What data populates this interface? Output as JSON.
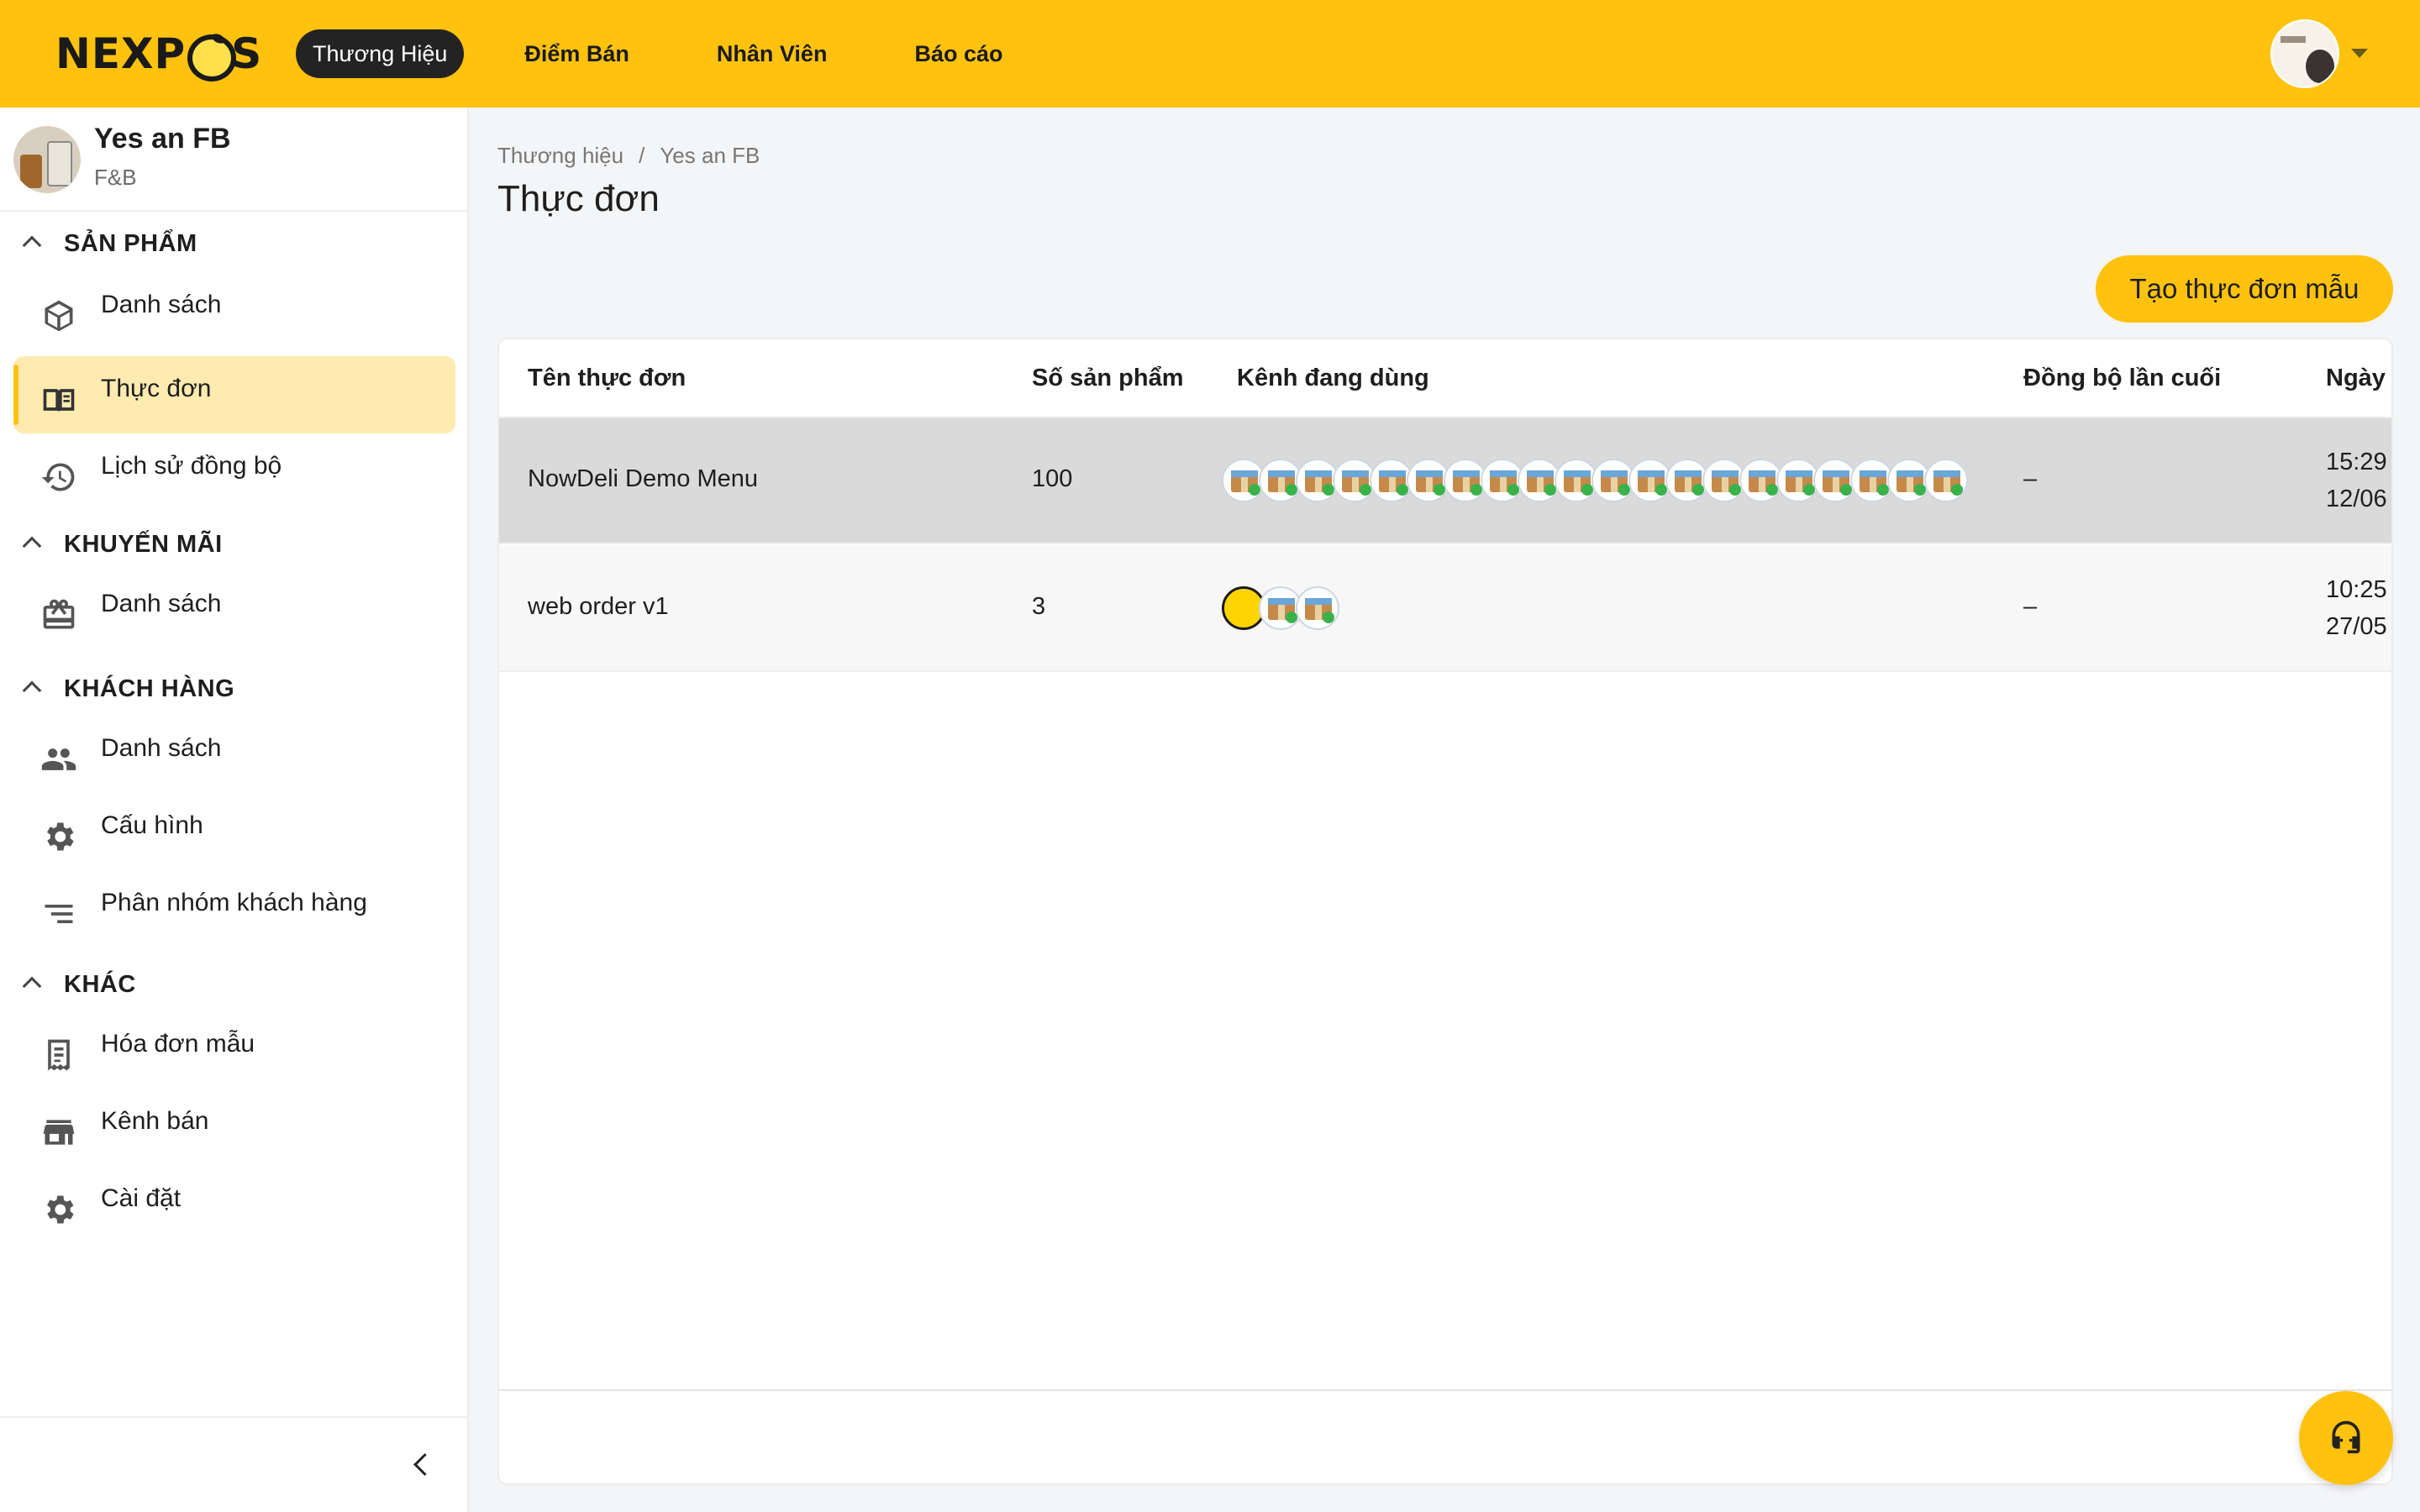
{
  "app": {
    "logo_text": "NEXPOS",
    "nav": [
      {
        "label": "Thương Hiệu",
        "active": true
      },
      {
        "label": "Điểm Bán",
        "active": false
      },
      {
        "label": "Nhân Viên",
        "active": false
      },
      {
        "label": "Báo cáo",
        "active": false
      }
    ],
    "accent_color": "#ffc20e"
  },
  "sidebar": {
    "brand": {
      "name": "Yes an FB",
      "category": "F&B"
    },
    "sections": [
      {
        "title": "SẢN PHẨM",
        "items": [
          {
            "label": "Danh sách",
            "icon": "package-icon",
            "active": false
          },
          {
            "label": "Thực đơn",
            "icon": "menu-book-icon",
            "active": true
          },
          {
            "label": "Lịch sử đồng bộ",
            "icon": "history-icon",
            "active": false
          }
        ]
      },
      {
        "title": "KHUYẾN MÃI",
        "items": [
          {
            "label": "Danh sách",
            "icon": "gift-card-icon",
            "active": false
          }
        ]
      },
      {
        "title": "KHÁCH HÀNG",
        "items": [
          {
            "label": "Danh sách",
            "icon": "people-icon",
            "active": false
          },
          {
            "label": "Cấu hình",
            "icon": "gear-icon",
            "active": false
          },
          {
            "label": "Phân nhóm khách hàng",
            "icon": "list-icon",
            "active": false
          }
        ]
      },
      {
        "title": "KHÁC",
        "items": [
          {
            "label": "Hóa đơn mẫu",
            "icon": "receipt-icon",
            "active": false
          },
          {
            "label": "Kênh bán",
            "icon": "store-icon",
            "active": false
          },
          {
            "label": "Cài đặt",
            "icon": "gear-icon",
            "active": false
          }
        ]
      }
    ]
  },
  "main": {
    "breadcrumb": [
      "Thương hiệu",
      "/",
      "Yes an FB"
    ],
    "title": "Thực đơn",
    "create_button": "Tạo thực đơn mẫu",
    "table": {
      "columns": [
        "Tên thực đơn",
        "Số sản phẩm",
        "Kênh đang dùng",
        "Đồng bộ lần cuối",
        "Ngày"
      ],
      "rows": [
        {
          "name": "NowDeli Demo Menu",
          "count": "100",
          "channel_count": 20,
          "last_sync": "–",
          "date_time": "15:29",
          "date_day": "12/06"
        },
        {
          "name": "web order v1",
          "count": "3",
          "channel_count": 3,
          "last_sync": "–",
          "date_time": "10:25",
          "date_day": "27/05"
        }
      ]
    }
  }
}
